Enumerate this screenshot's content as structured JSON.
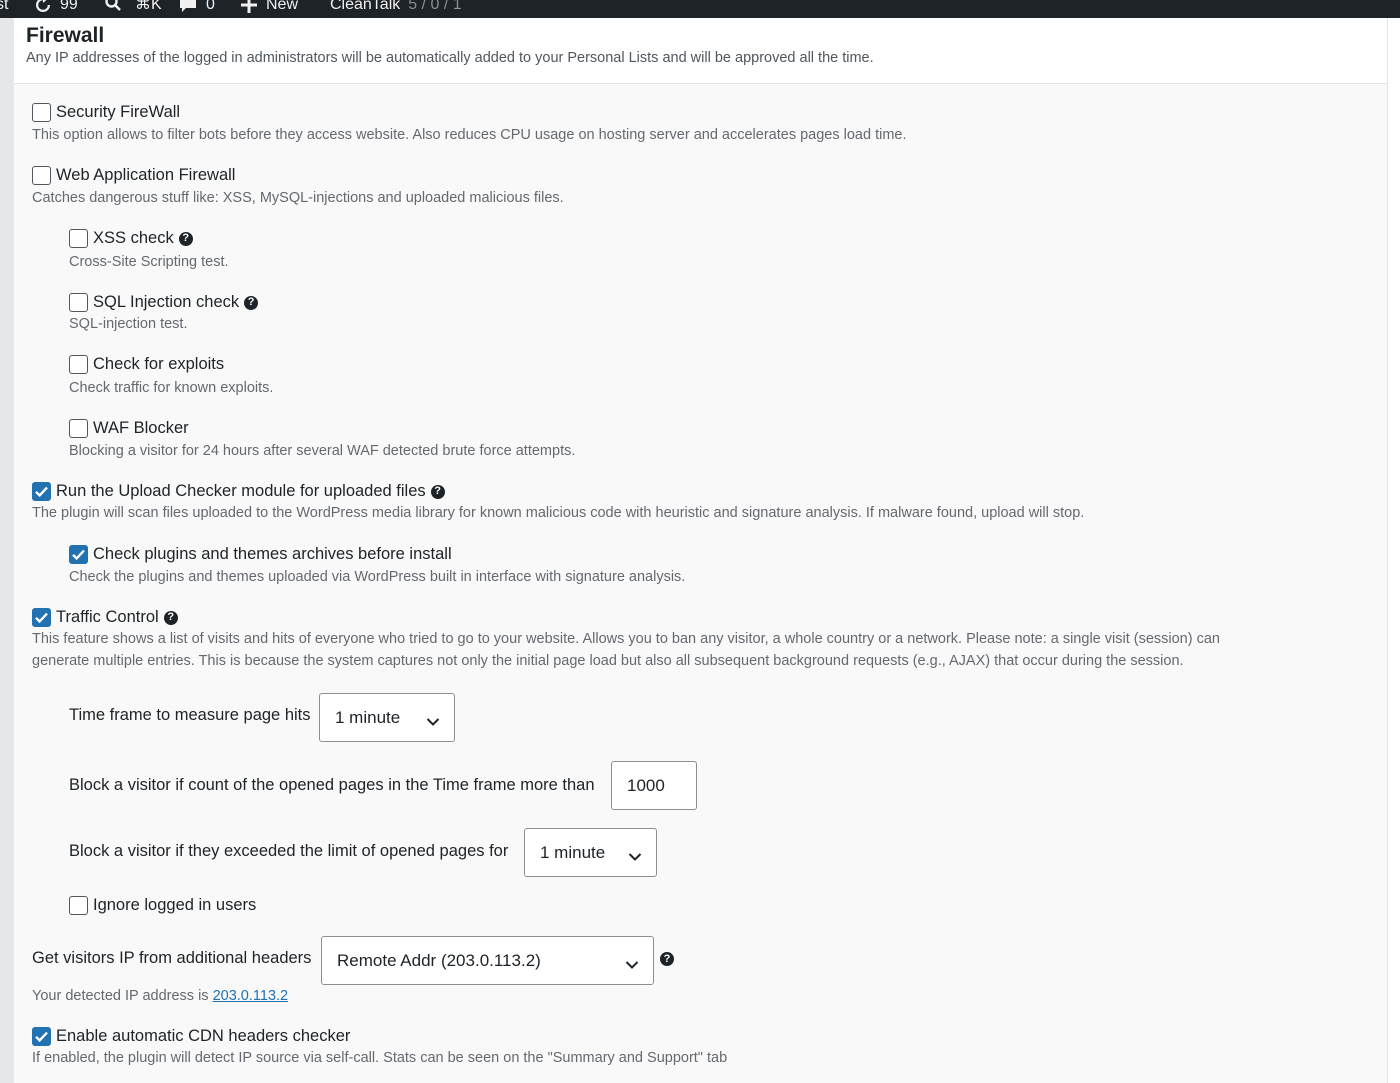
{
  "adminbar": {
    "items": [
      {
        "icon": "site-icon",
        "text": "st"
      },
      {
        "icon": "updates-icon",
        "text": "99"
      },
      {
        "icon": "search-icon",
        "text": ""
      },
      {
        "icon": "shortcut-icon",
        "text": "⌘K"
      },
      {
        "icon": "comments-icon",
        "text": "0"
      },
      {
        "icon": "plus-icon",
        "text": "New"
      }
    ],
    "plugin_label": "CleanTalk",
    "plugin_counts": "5 / 0 / 1"
  },
  "section": {
    "title": "Firewall",
    "subtitle": "Any IP addresses of the logged in administrators will be automatically added to your Personal Lists and will be approved all the time."
  },
  "options": {
    "security_firewall": {
      "label": "Security FireWall",
      "checked": false,
      "desc": "This option allows to filter bots before they access website. Also reduces CPU usage on hosting server and accelerates pages load time."
    },
    "waf": {
      "label": "Web Application Firewall",
      "checked": false,
      "desc": "Catches dangerous stuff like: XSS, MySQL-injections and uploaded malicious files."
    },
    "xss": {
      "label": "XSS check",
      "checked": false,
      "desc": "Cross-Site Scripting test."
    },
    "sql": {
      "label": "SQL Injection check",
      "checked": false,
      "desc": "SQL-injection test."
    },
    "exploits": {
      "label": "Check for exploits",
      "checked": false,
      "desc": "Check traffic for known exploits."
    },
    "waf_blocker": {
      "label": "WAF Blocker",
      "checked": false,
      "desc": "Blocking a visitor for 24 hours after several WAF detected brute force attempts."
    },
    "upload_checker": {
      "label": "Run the Upload Checker module for uploaded files",
      "checked": true,
      "desc": "The plugin will scan files uploaded to the WordPress media library for known malicious code with heuristic and signature analysis. If malware found, upload will stop."
    },
    "archives": {
      "label": "Check plugins and themes archives before install",
      "checked": true,
      "desc": "Check the plugins and themes uploaded via WordPress built in interface with signature analysis."
    },
    "traffic_control": {
      "label": "Traffic Control",
      "checked": true,
      "desc_line1": "This feature shows a list of visits and hits of everyone who tried to go to your website. Allows you to ban any visitor, a whole country or a network. Please note: a single visit (session) can",
      "desc_line2": "generate multiple entries. This is because the system captures not only the initial page load but also all subsequent background requests (e.g., AJAX) that occur during the session."
    },
    "ignore_logged": {
      "label": "Ignore logged in users",
      "checked": false
    },
    "cdn_checker": {
      "label": "Enable automatic CDN headers checker",
      "checked": true,
      "desc": "If enabled, the plugin will detect IP source via self-call. Stats can be seen on the \"Summary and Support\" tab"
    }
  },
  "fields": {
    "time_frame": {
      "label": "Time frame to measure page hits",
      "value": "1 minute"
    },
    "page_limit": {
      "label": "Block a visitor if count of the opened pages in the Time frame more than",
      "value": "1000"
    },
    "block_period": {
      "label": "Block a visitor if they exceeded the limit of opened pages for",
      "value": "1 minute"
    },
    "ip_headers": {
      "label": "Get visitors IP from additional headers",
      "value": "Remote Addr (203.0.113.2)"
    }
  },
  "detected_ip": {
    "prefix": "Your detected IP address is",
    "ip": "203.0.113.2"
  },
  "colors": {
    "accent": "#2271b1",
    "adminbar": "#1d2327",
    "text": "#1d2327",
    "muted": "#646970"
  }
}
